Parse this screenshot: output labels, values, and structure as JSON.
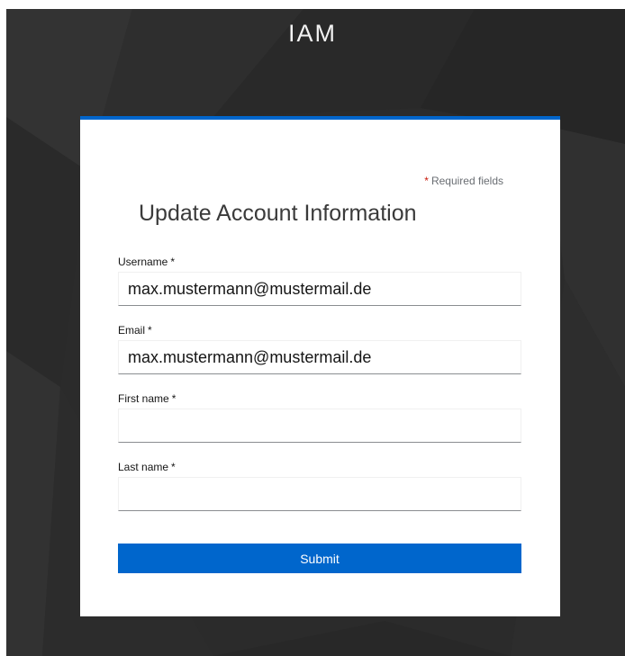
{
  "header": {
    "app_title": "IAM"
  },
  "form": {
    "required_note_marker": "*",
    "required_note_text": "Required fields",
    "title": "Update Account Information",
    "required_marker": "*",
    "fields": [
      {
        "label": "Username",
        "value": "max.mustermann@mustermail.de"
      },
      {
        "label": "Email",
        "value": "max.mustermann@mustermail.de"
      },
      {
        "label": "First name",
        "value": ""
      },
      {
        "label": "Last name",
        "value": ""
      }
    ],
    "submit_label": "Submit"
  },
  "colors": {
    "accent": "#0066cc",
    "background": "#2b2b2b",
    "required_star": "#c9190b"
  }
}
